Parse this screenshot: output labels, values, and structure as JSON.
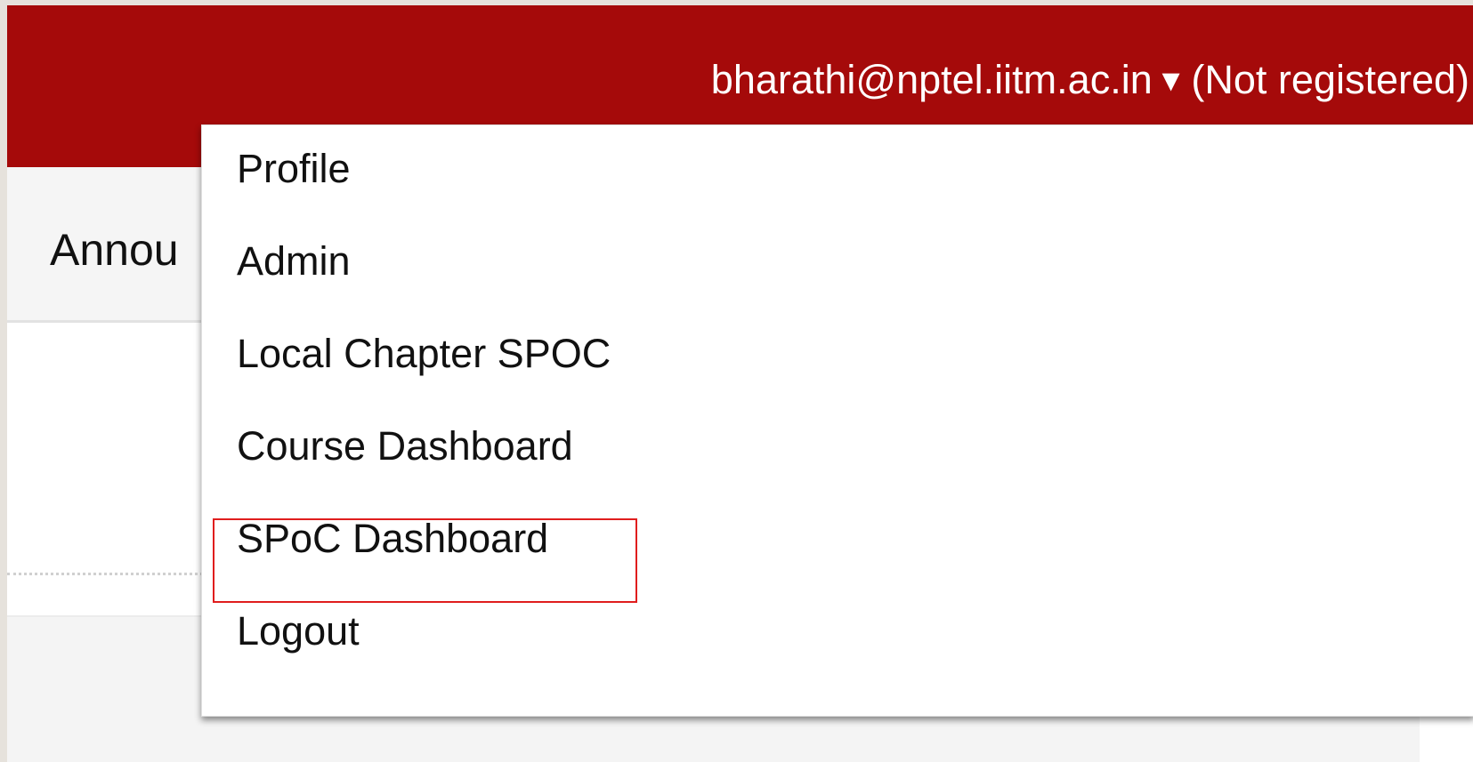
{
  "header": {
    "user_email": "bharathi@nptel.iitm.ac.in",
    "caret": "▼",
    "registration_status": "(Not registered)"
  },
  "tabs": [
    {
      "label": "Annou"
    }
  ],
  "user_menu": {
    "items": [
      {
        "label": "Profile"
      },
      {
        "label": "Admin"
      },
      {
        "label": "Local Chapter SPOC"
      },
      {
        "label": "Course Dashboard"
      },
      {
        "label": "SPoC Dashboard",
        "highlighted": true
      },
      {
        "label": "Logout"
      }
    ]
  },
  "colors": {
    "header_background": "#a50a0a",
    "highlight_border": "#e01d1d",
    "tabbar_background": "#f5f5f5"
  }
}
